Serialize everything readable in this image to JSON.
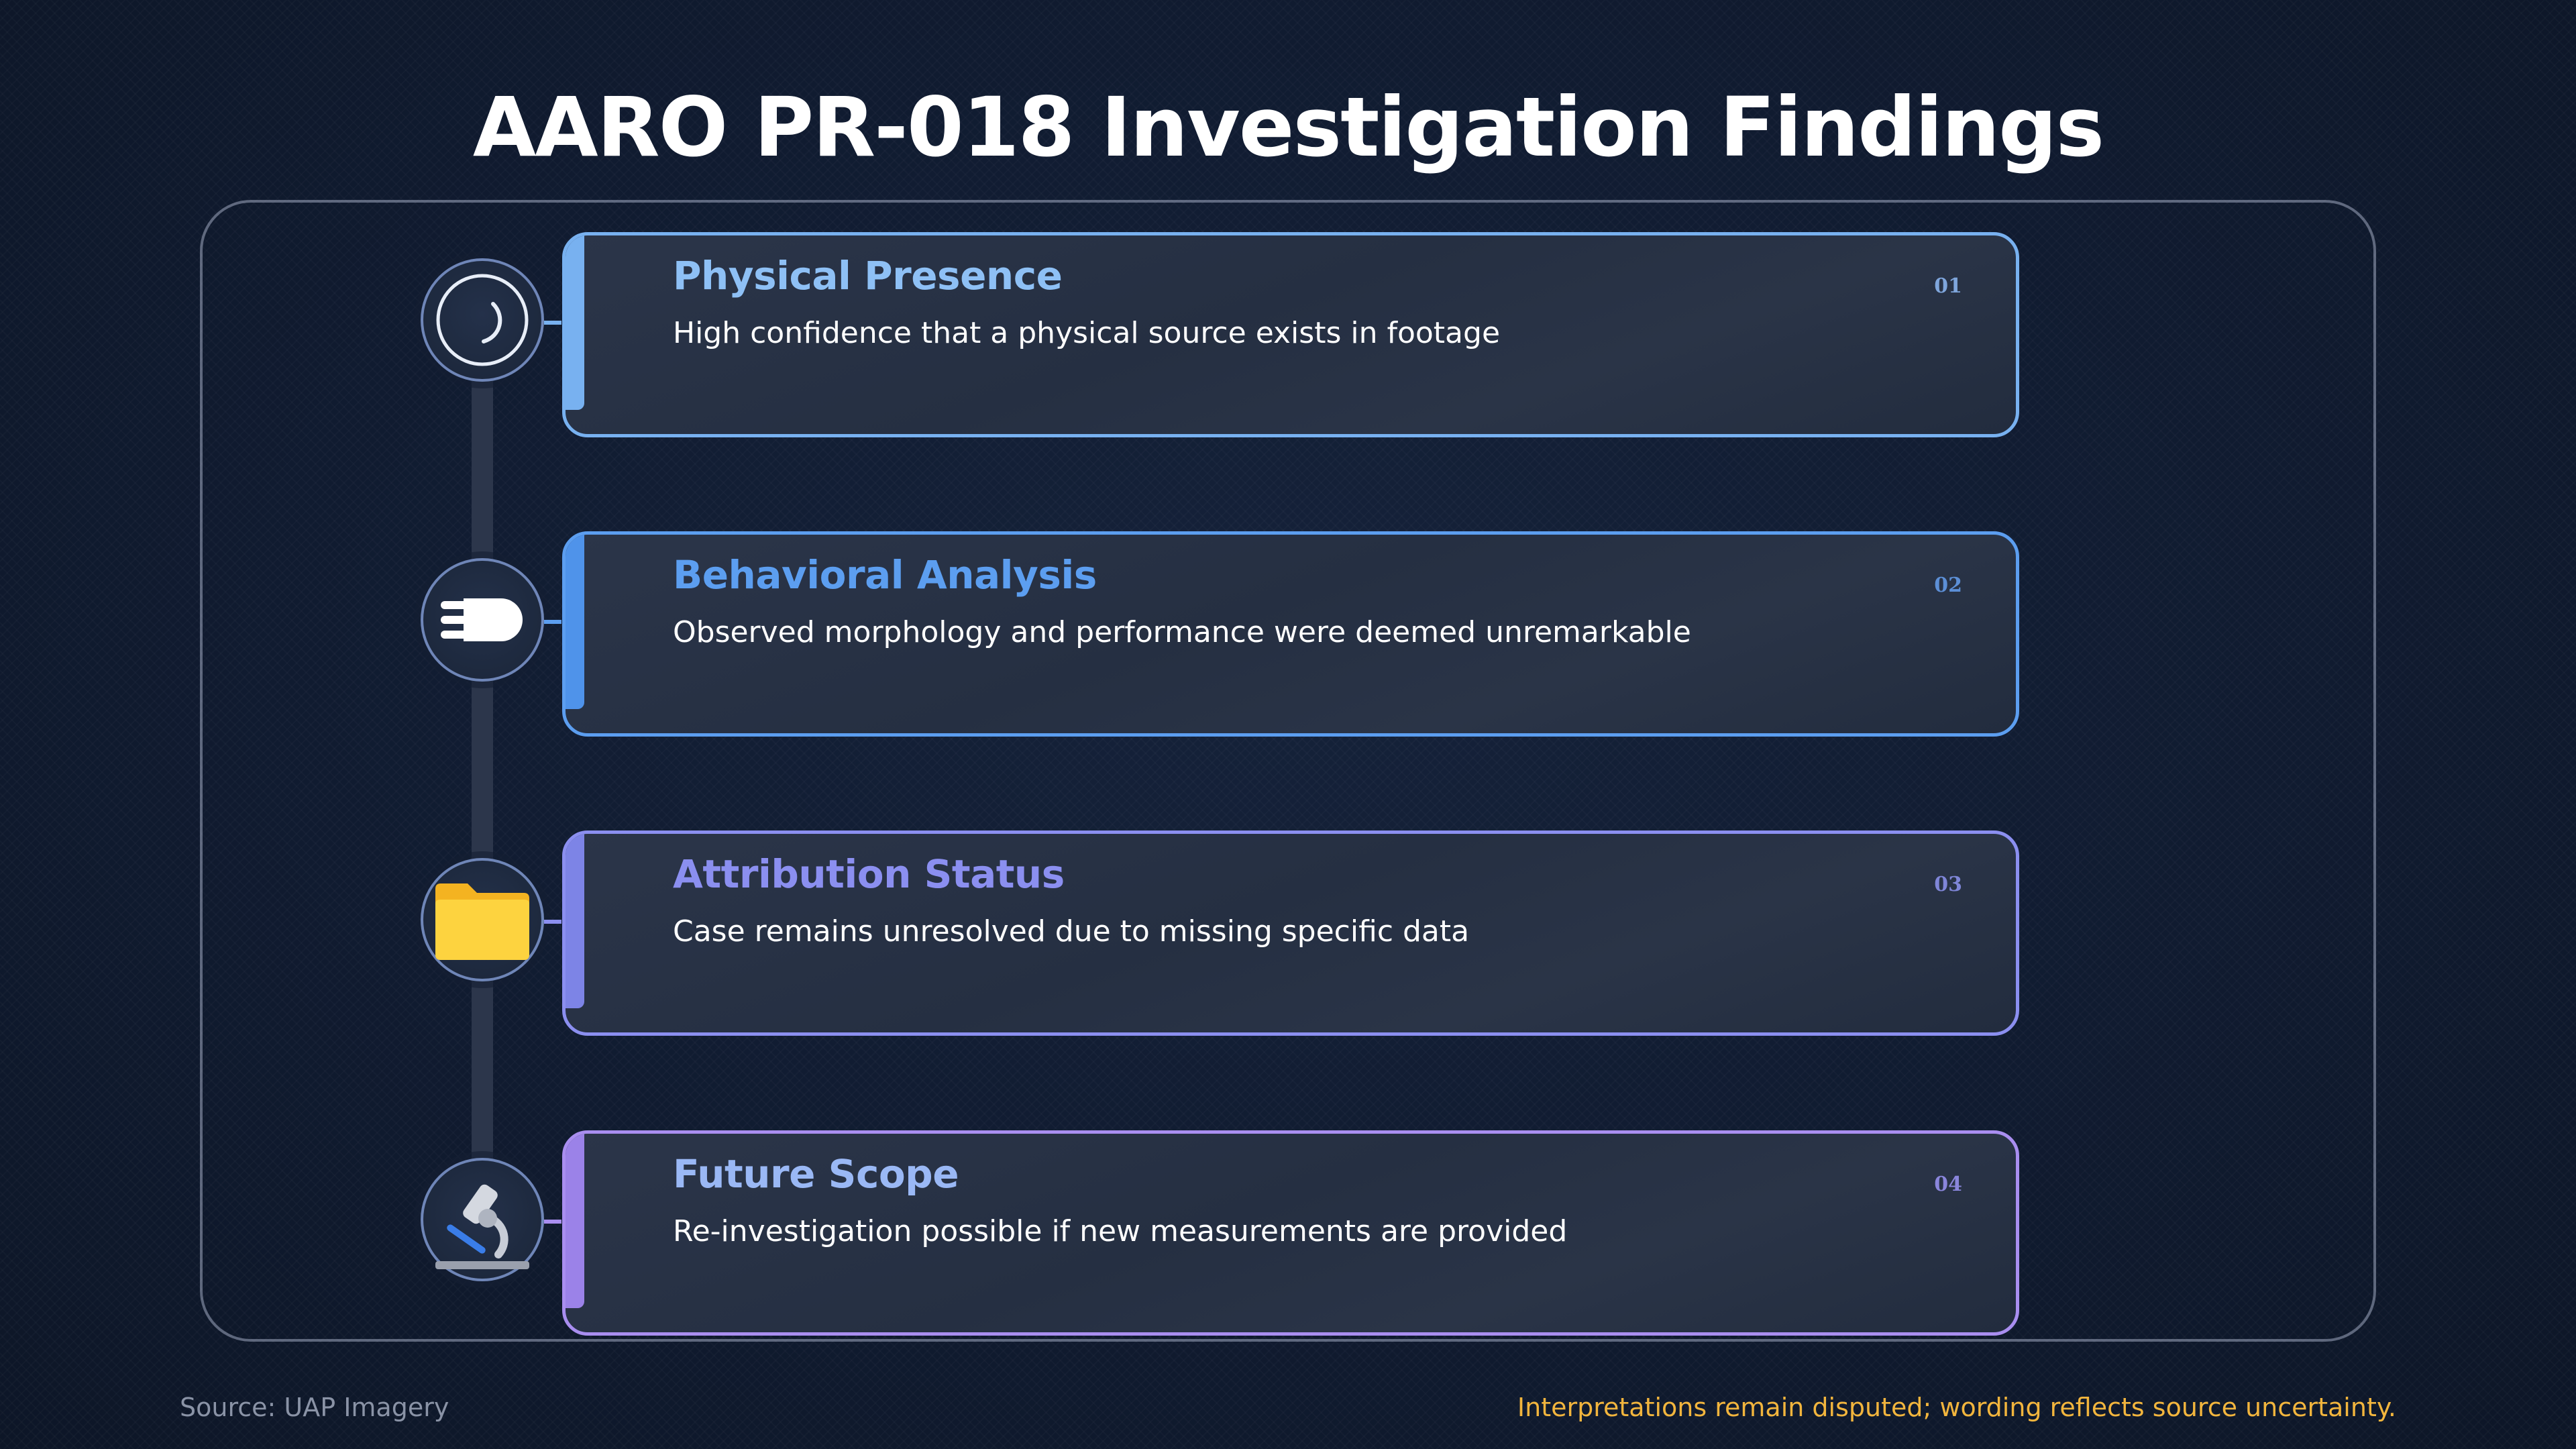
{
  "title": "AARO PR-018 Investigation Findings",
  "colors": {
    "background": "#101b30",
    "spine": "#2c364b",
    "footer_note": "#f2b53d",
    "source": "#8a93a6"
  },
  "findings": [
    {
      "number": "01",
      "heading": "Physical Presence",
      "description": "High confidence that a physical source exists in footage",
      "icon": "crescent-moon-icon",
      "color": "#8ec0f5",
      "border_color": "#78b1f0"
    },
    {
      "number": "02",
      "heading": "Behavioral Analysis",
      "description": "Observed morphology and performance were deemed unremarkable",
      "icon": "comet-icon",
      "color": "#5c9ef0",
      "border_color": "#5c9ef0"
    },
    {
      "number": "03",
      "heading": "Attribution Status",
      "description": "Case remains unresolved due to missing specific data",
      "icon": "folder-icon",
      "color": "#8b8ff0",
      "border_color": "#8b8ff0"
    },
    {
      "number": "04",
      "heading": "Future Scope",
      "description": "Re-investigation possible if new measurements are provided",
      "icon": "microscope-icon",
      "color": "#9aa3f5",
      "border_color": "#a98ef0"
    }
  ],
  "footer": {
    "source": "Source: UAP Imagery",
    "note": "Interpretations remain disputed; wording reflects source uncertainty."
  }
}
